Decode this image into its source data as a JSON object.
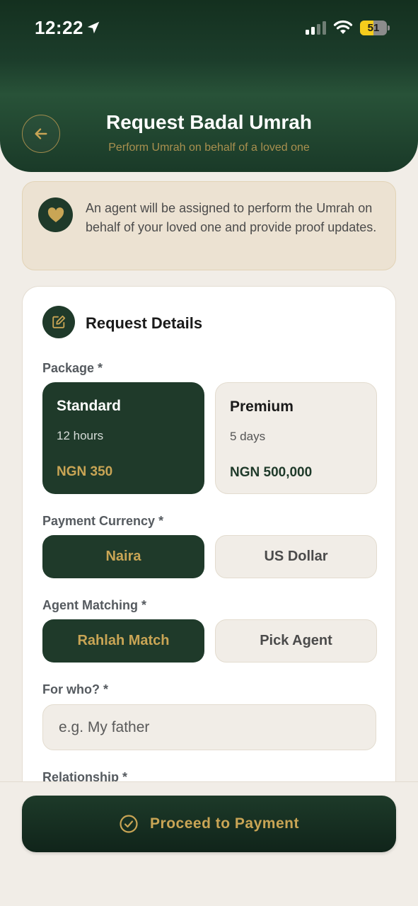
{
  "status_bar": {
    "time": "12:22",
    "battery": "51",
    "battery_level": 0.51
  },
  "header": {
    "title": "Request Badal Umrah",
    "subtitle": "Perform Umrah on behalf of a loved one"
  },
  "info": {
    "text": "An agent will be assigned to perform the Umrah on behalf of your loved one and provide proof updates."
  },
  "form": {
    "section_title": "Request Details",
    "package_label": "Package *",
    "packages": [
      {
        "name": "Standard",
        "duration": "12 hours",
        "price": "NGN 350"
      },
      {
        "name": "Premium",
        "duration": "5 days",
        "price": "NGN 500,000"
      }
    ],
    "currency_label": "Payment Currency *",
    "currencies": [
      "Naira",
      "US Dollar"
    ],
    "agent_label": "Agent Matching *",
    "agent_options": [
      "Rahlah Match",
      "Pick Agent"
    ],
    "for_who_label": "For who? *",
    "for_who_placeholder": "e.g. My father",
    "relationship_label": "Relationship *"
  },
  "footer": {
    "proceed_label": "Proceed to Payment"
  },
  "colors": {
    "primary": "#1f3a2a",
    "accent_gold": "#c9a555",
    "background": "#f1ede7",
    "info_bg": "#ece2d2"
  }
}
